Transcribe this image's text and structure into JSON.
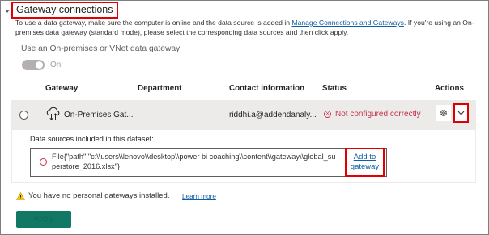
{
  "section": {
    "title": "Gateway connections",
    "description_prefix": "To use a data gateway, make sure the computer is online and the data source is added in ",
    "description_link": "Manage Connections and Gateways",
    "description_suffix": ". If you're using an On-premises data gateway (standard mode), please select the corresponding data sources and then click apply."
  },
  "toggle": {
    "label": "Use an On-premises or VNet data gateway",
    "state_text": "On",
    "enabled": false
  },
  "table": {
    "headers": [
      "Gateway",
      "Department",
      "Contact information",
      "Status",
      "Actions"
    ],
    "rows": [
      {
        "gateway": "On-Premises Gat...",
        "department": "",
        "contact": "riddhi.a@addendanaly...",
        "status": "Not configured correctly",
        "gateway_icon": "cloud-gateway-icon",
        "status_icon": "error-circle-icon"
      }
    ]
  },
  "datasources": {
    "title": "Data sources included in this dataset:",
    "items": [
      {
        "path": "File{\"path\":\"c:\\\\users\\\\lenovo\\\\desktop\\\\power bi coaching\\\\content\\\\gateway\\\\global_superstore_2016.xlsx\"}",
        "action_label": "Add to gateway"
      }
    ]
  },
  "warning": {
    "text": "You have no personal gateways installed.",
    "link": "Learn more",
    "icon": "warning-icon"
  },
  "apply_button": {
    "label": "Apply"
  },
  "colors": {
    "accent": "#117865",
    "error": "#c4314b",
    "link": "#115ea3",
    "highlight": "#e00000",
    "row_bg": "#edebe9"
  }
}
